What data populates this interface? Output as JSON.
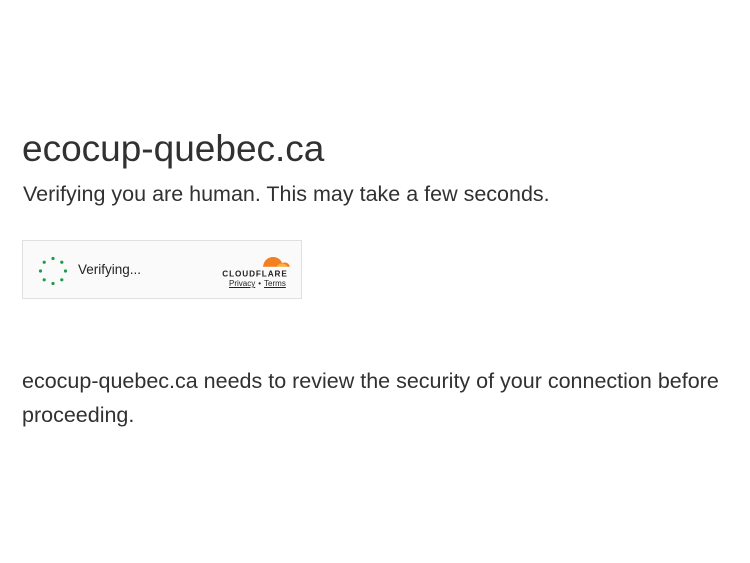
{
  "page": {
    "site_title": "ecocup-quebec.ca",
    "subtitle": "Verifying you are human. This may take a few seconds.",
    "message": "ecocup-quebec.ca needs to review the security of your connection before proceeding."
  },
  "widget": {
    "status_label": "Verifying...",
    "spinner_icon": "loading-spinner-icon",
    "logo_text": "CLOUDFLARE",
    "privacy_link": "Privacy",
    "separator": "•",
    "terms_link": "Terms"
  },
  "colors": {
    "text": "#313131",
    "spinner": "#1a9e46",
    "cloudflare_orange": "#f38020",
    "cloudflare_light_orange": "#faae40",
    "widget_border": "#e0e0e0",
    "widget_background": "#fafafa"
  }
}
